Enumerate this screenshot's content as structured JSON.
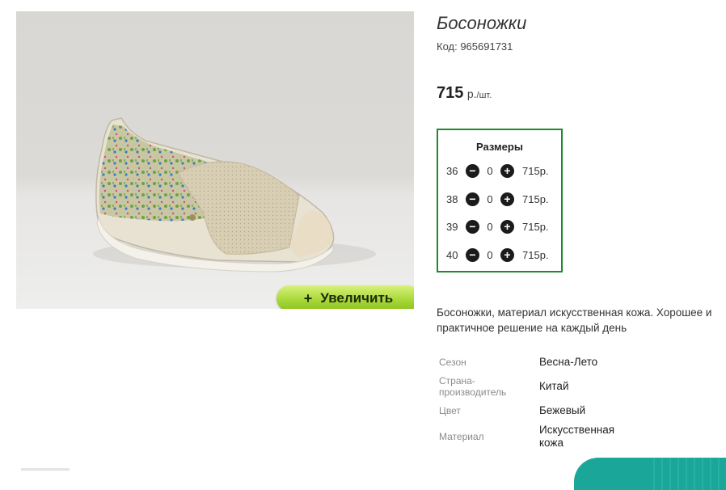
{
  "product": {
    "title": "Босоножки",
    "code": "Код: 965691731",
    "price": "715",
    "price_currency": "р.",
    "price_per": "/шт.",
    "zoom_button": "Увеличить",
    "zoom_plus": "+",
    "description": "Босоножки, материал искусственная кожа. Хорошее и практичное решение на каждый день"
  },
  "sizes": {
    "title": "Размеры",
    "rows": [
      {
        "size": "36",
        "qty": "0",
        "price": "715р."
      },
      {
        "size": "38",
        "qty": "0",
        "price": "715р."
      },
      {
        "size": "39",
        "qty": "0",
        "price": "715р."
      },
      {
        "size": "40",
        "qty": "0",
        "price": "715р."
      }
    ],
    "minus_icon": "minus-circle-icon",
    "plus_icon": "plus-circle-icon"
  },
  "properties": [
    {
      "key": "Сезон",
      "value": "Весна-Лето"
    },
    {
      "key": "Страна-производитель",
      "value": "Китай"
    },
    {
      "key": "Цвет",
      "value": "Бежевый"
    },
    {
      "key": "Материал",
      "value": "Искусственная кожа"
    }
  ],
  "colors": {
    "accent_border": "#1e8a2c",
    "zoom_button": "#a8d83a",
    "corner_strip": "#1aa79a"
  }
}
